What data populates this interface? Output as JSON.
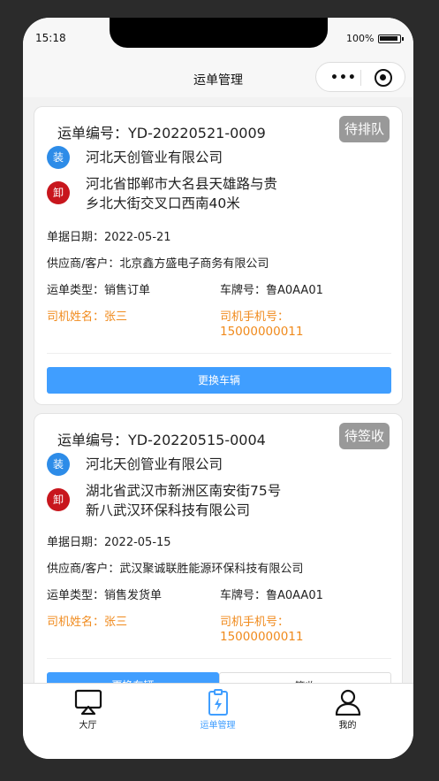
{
  "status_bar": {
    "time": "15:18",
    "battery": "100%"
  },
  "nav": {
    "title": "运单管理"
  },
  "cards": [
    {
      "order_label": "运单编号：",
      "order_no": "YD-20220521-0009",
      "status": "待排队",
      "load_tag": "装",
      "load_company": "河北天创管业有限公司",
      "unload_tag": "卸",
      "unload_address_line1": "河北省邯郸市大名县天雄路与贵",
      "unload_address_line2": "乡北大街交叉口西南40米",
      "date_label": "单据日期：",
      "date": "2022-05-21",
      "supplier_label": "供应商/客户：",
      "supplier": "北京鑫方盛电子商务有限公司",
      "type_label": "运单类型：",
      "type": "销售订单",
      "plate_label": "车牌号：",
      "plate": "鲁A0AA01",
      "driver_label": "司机姓名：",
      "driver": "张三",
      "phone_label": "司机手机号：",
      "phone": "15000000011",
      "button": "更换车辆"
    },
    {
      "order_label": "运单编号：",
      "order_no": "YD-20220515-0004",
      "status": "待签收",
      "load_tag": "装",
      "load_company": "河北天创管业有限公司",
      "unload_tag": "卸",
      "unload_address_line1": "湖北省武汉市新洲区南安街75号",
      "unload_address_line2": "新八武汉环保科技有限公司",
      "date_label": "单据日期：",
      "date": "2022-05-15",
      "supplier_label": "供应商/客户：",
      "supplier": "武汉聚诚联胜能源环保科技有限公司",
      "type_label": "运单类型：",
      "type": "销售发货单",
      "plate_label": "车牌号：",
      "plate": "鲁A0AA01",
      "driver_label": "司机姓名：",
      "driver": "张三",
      "phone_label": "司机手机号：",
      "phone": "15000000011",
      "button_left": "更换车辆",
      "button_right": "签收"
    }
  ],
  "tabs": [
    {
      "label": "大厅",
      "icon": "airplay-icon"
    },
    {
      "label": "运单管理",
      "icon": "clipboard-icon"
    },
    {
      "label": "我的",
      "icon": "user-icon"
    }
  ],
  "colors": {
    "accent": "#409eff",
    "orange": "#f08a1c",
    "load": "#2d8ce8",
    "unload": "#c8161d",
    "badge": "#999999"
  }
}
